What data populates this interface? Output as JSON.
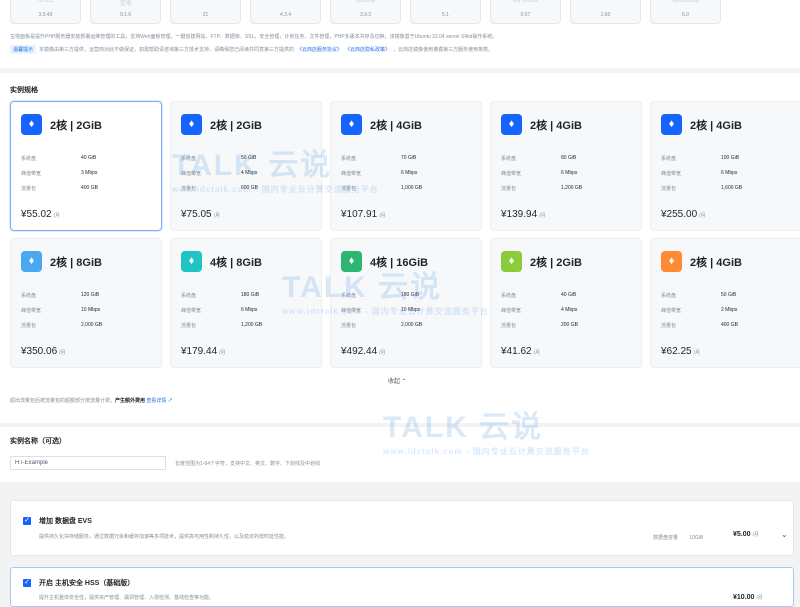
{
  "images": [
    {
      "name": "RHEL",
      "version": "3.0.43"
    },
    {
      "name": "宝塔",
      "version": "9.1.6"
    },
    {
      "name": "",
      "version": "21"
    },
    {
      "name": "",
      "version": "4.3.4"
    },
    {
      "name": "Joomla",
      "version": "3.9.3"
    },
    {
      "name": "",
      "version": "5.1"
    },
    {
      "name": "My Office",
      "version": "0.67"
    },
    {
      "name": "",
      "version": "1.60"
    },
    {
      "name": "Nextcloud",
      "version": "6.0"
    }
  ],
  "image_desc": "宝塔面板是提升PHP服务器安装部署运维管理的工具，支持Web面板管理，一键创建网站、FTP、数据库、SSL，安全管理，计划任务，文件管理，PHP多版本共存及切换。该镜像基于Ubuntu 22.04 server 64bit操作系统。",
  "image_desc2": {
    "tag": "温馨提示",
    "text": "本镜像由第三方提供，运营商对此不做保证，如需帮助请咨询第三方技术支持，请确保您已阅读并同意第三方提供的",
    "link1": "《云商店服务协议》",
    "link2": "《云商店隐私政策》",
    "tail": "，云商店镜像使用遵循第三方服务使用条款。"
  },
  "spec_section": {
    "title": "实例规格"
  },
  "spec_labels": {
    "disk": "系统盘",
    "bandwidth": "峰值带宽",
    "traffic": "流量包"
  },
  "specs": [
    {
      "title": "2核 | 2GiB",
      "disk": "40 GiB",
      "bandwidth": "3 Mbps",
      "traffic": "400 GB",
      "price": "¥55.02",
      "unit": "/月",
      "icon": "diamond-icon",
      "color": "#1664ff",
      "selected": true
    },
    {
      "title": "2核 | 2GiB",
      "disk": "50 GiB",
      "bandwidth": "4 Mbps",
      "traffic": "600 GB",
      "price": "¥75.05",
      "unit": "/月",
      "icon": "diamond-icon",
      "color": "#1664ff",
      "selected": false
    },
    {
      "title": "2核 | 4GiB",
      "disk": "70 GiB",
      "bandwidth": "6 Mbps",
      "traffic": "1,000 GB",
      "price": "¥107.91",
      "unit": "/月",
      "icon": "diamond-icon",
      "color": "#1664ff",
      "selected": false
    },
    {
      "title": "2核 | 4GiB",
      "disk": "80 GiB",
      "bandwidth": "6 Mbps",
      "traffic": "1,200 GB",
      "price": "¥139.94",
      "unit": "/月",
      "icon": "diamond-icon",
      "color": "#1664ff",
      "selected": false
    },
    {
      "title": "2核 | 4GiB",
      "disk": "100 GiB",
      "bandwidth": "6 Mbps",
      "traffic": "1,600 GB",
      "price": "¥255.00",
      "unit": "/月",
      "icon": "diamond-icon",
      "color": "#1664ff",
      "selected": false
    },
    {
      "title": "2核 | 8GiB",
      "disk": "120 GiB",
      "bandwidth": "10 Mbps",
      "traffic": "2,000 GB",
      "price": "¥350.06",
      "unit": "/月",
      "icon": "diamond-icon",
      "color": "#4aa8f0",
      "selected": false
    },
    {
      "title": "4核 | 8GiB",
      "disk": "180 GiB",
      "bandwidth": "6 Mbps",
      "traffic": "1,200 GB",
      "price": "¥179.44",
      "unit": "/月",
      "icon": "diamond-icon",
      "color": "#1fc4c4",
      "selected": false
    },
    {
      "title": "4核 | 16GiB",
      "disk": "180 GiB",
      "bandwidth": "10 Mbps",
      "traffic": "2,000 GB",
      "price": "¥492.44",
      "unit": "/月",
      "icon": "diamond-icon",
      "color": "#2bb673",
      "selected": false
    },
    {
      "title": "2核 | 2GiB",
      "disk": "40 GiB",
      "bandwidth": "4 Mbps",
      "traffic": "200 GB",
      "price": "¥41.62",
      "unit": "/月",
      "icon": "diamond-icon",
      "color": "#8ccc3a",
      "selected": false
    },
    {
      "title": "2核 | 4GiB",
      "disk": "50 GiB",
      "bandwidth": "2 Mbps",
      "traffic": "400 GB",
      "price": "¥62.25",
      "unit": "/月",
      "icon": "diamond-icon",
      "color": "#ff8a33",
      "selected": false
    }
  ],
  "collapse_label": "收起 ⌃",
  "note": {
    "text": "超出流量包后按流量包的超额部分按流量计费，",
    "bold": "产生额外费用",
    "link": "查看详情 ↗"
  },
  "name_section": {
    "title": "实例名称（可选）",
    "value": "HT-Example",
    "hint": "长度范围为1-64个字符，支持中文、英文、数字、下划线及中划线"
  },
  "addons": [
    {
      "title": "增加 数据盘 EVS",
      "desc": "提供持久化块存储服务，通过数据冗余和缓存加速等多项技术，提供高可用性和持久性，以及稳定的低时延性能。",
      "spec": "数据盘容量",
      "size": "10GiB",
      "price": "¥5.00",
      "unit": "/月",
      "checked": true
    },
    {
      "title": "开启 主机安全 HSS（基础版）",
      "desc": "提升主机整体安全性，提供资产管理、漏洞管理、入侵检测、基线检查等功能。",
      "price": "¥10.00",
      "unit": "/月",
      "checked": true
    }
  ],
  "watermark": {
    "logo": "TALK 云说",
    "url": "www.idctalk.com - 国内专业云计算交流服务平台"
  },
  "accent_color": "#1664ff"
}
